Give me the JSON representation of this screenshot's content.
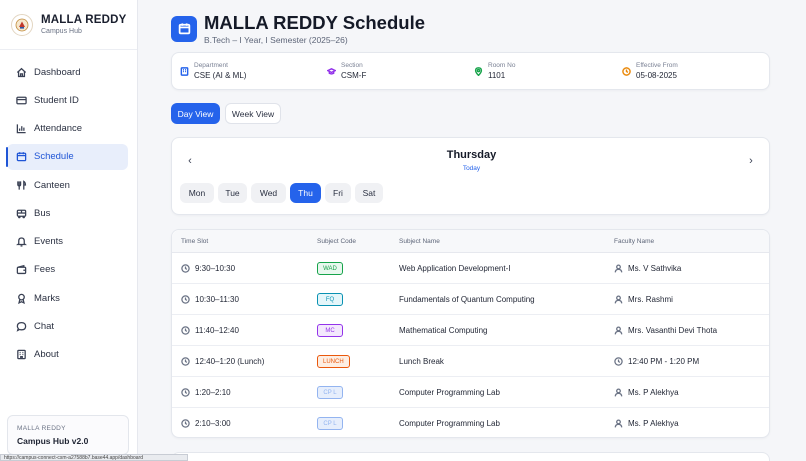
{
  "brand": {
    "title": "MALLA REDDY",
    "subtitle": "Campus Hub"
  },
  "sidebar": {
    "items": [
      {
        "label": "Dashboard",
        "icon": "home-icon"
      },
      {
        "label": "Student ID",
        "icon": "id-card-icon"
      },
      {
        "label": "Attendance",
        "icon": "bar-chart-icon"
      },
      {
        "label": "Schedule",
        "icon": "calendar-icon",
        "active": true
      },
      {
        "label": "Canteen",
        "icon": "utensils-icon"
      },
      {
        "label": "Bus",
        "icon": "bus-icon"
      },
      {
        "label": "Events",
        "icon": "bell-icon"
      },
      {
        "label": "Fees",
        "icon": "wallet-icon"
      },
      {
        "label": "Marks",
        "icon": "award-icon"
      },
      {
        "label": "Chat",
        "icon": "chat-bubble-icon"
      },
      {
        "label": "About",
        "icon": "building-icon"
      }
    ],
    "footer": {
      "line1": "MALLA REDDY",
      "line2": "Campus Hub v2.0"
    }
  },
  "header": {
    "title": "MALLA REDDY Schedule",
    "subtitle": "B.Tech – I Year, I Semester (2025–26)"
  },
  "info": {
    "department": {
      "label": "Department",
      "value": "CSE (AI & ML)"
    },
    "section": {
      "label": "Section",
      "value": "CSM-F"
    },
    "room": {
      "label": "Room No",
      "value": "1101"
    },
    "effective": {
      "label": "Effective From",
      "value": "05-08-2025"
    }
  },
  "views": {
    "day": "Day View",
    "week": "Week View",
    "active": "day"
  },
  "day_selector": {
    "current_day": "Thursday",
    "today_label": "Today",
    "prev_arrow": "‹",
    "next_arrow": "›",
    "days": [
      "Mon",
      "Tue",
      "Wed",
      "Thu",
      "Fri",
      "Sat"
    ],
    "active_day": "Thu"
  },
  "table": {
    "headers": [
      "Time Slot",
      "Subject Code",
      "Subject Name",
      "Faculty Name"
    ],
    "rows": [
      {
        "time": "9:30–10:30",
        "code": "WAD",
        "subject": "Web Application Development-I",
        "faculty": "Ms. V Sathvika",
        "faculty_icon": "user-icon",
        "badge_color": "#16a34a",
        "badge_bg": "#e8f7ee"
      },
      {
        "time": "10:30–11:30",
        "code": "FQ",
        "subject": "Fundamentals of Quantum Computing",
        "faculty": "Mrs. Rashmi",
        "faculty_icon": "user-icon",
        "badge_color": "#0891b2",
        "badge_bg": "#e4f6fa"
      },
      {
        "time": "11:40–12:40",
        "code": "MC",
        "subject": "Mathematical Computing",
        "faculty": "Mrs. Vasanthi Devi Thota",
        "faculty_icon": "user-icon",
        "badge_color": "#9333ea",
        "badge_bg": "#f3e8fd"
      },
      {
        "time": "12:40–1:20 (Lunch)",
        "code": "LUNCH",
        "subject": "Lunch Break",
        "faculty": "12:40 PM - 1:20 PM",
        "faculty_icon": "clock-icon",
        "badge_color": "#ea580c",
        "badge_bg": "#fdeee3"
      },
      {
        "time": "1:20–2:10",
        "code": "CP L",
        "subject": "Computer Programming Lab",
        "faculty": "Ms. P Alekhya",
        "faculty_icon": "user-icon",
        "badge_color": "#93b4f0",
        "badge_bg": "#e6eefc"
      },
      {
        "time": "2:10–3:00",
        "code": "CP L",
        "subject": "Computer Programming Lab",
        "faculty": "Ms. P Alekhya",
        "faculty_icon": "user-icon",
        "badge_color": "#93b4f0",
        "badge_bg": "#e6eefc"
      }
    ]
  },
  "status_bar": {
    "url": "https://campus-connect-csm-a27588b7.base44.app/dashboard"
  },
  "colors": {
    "accent": "#2563eb",
    "sidebar_active_bg": "#e8eefb"
  }
}
